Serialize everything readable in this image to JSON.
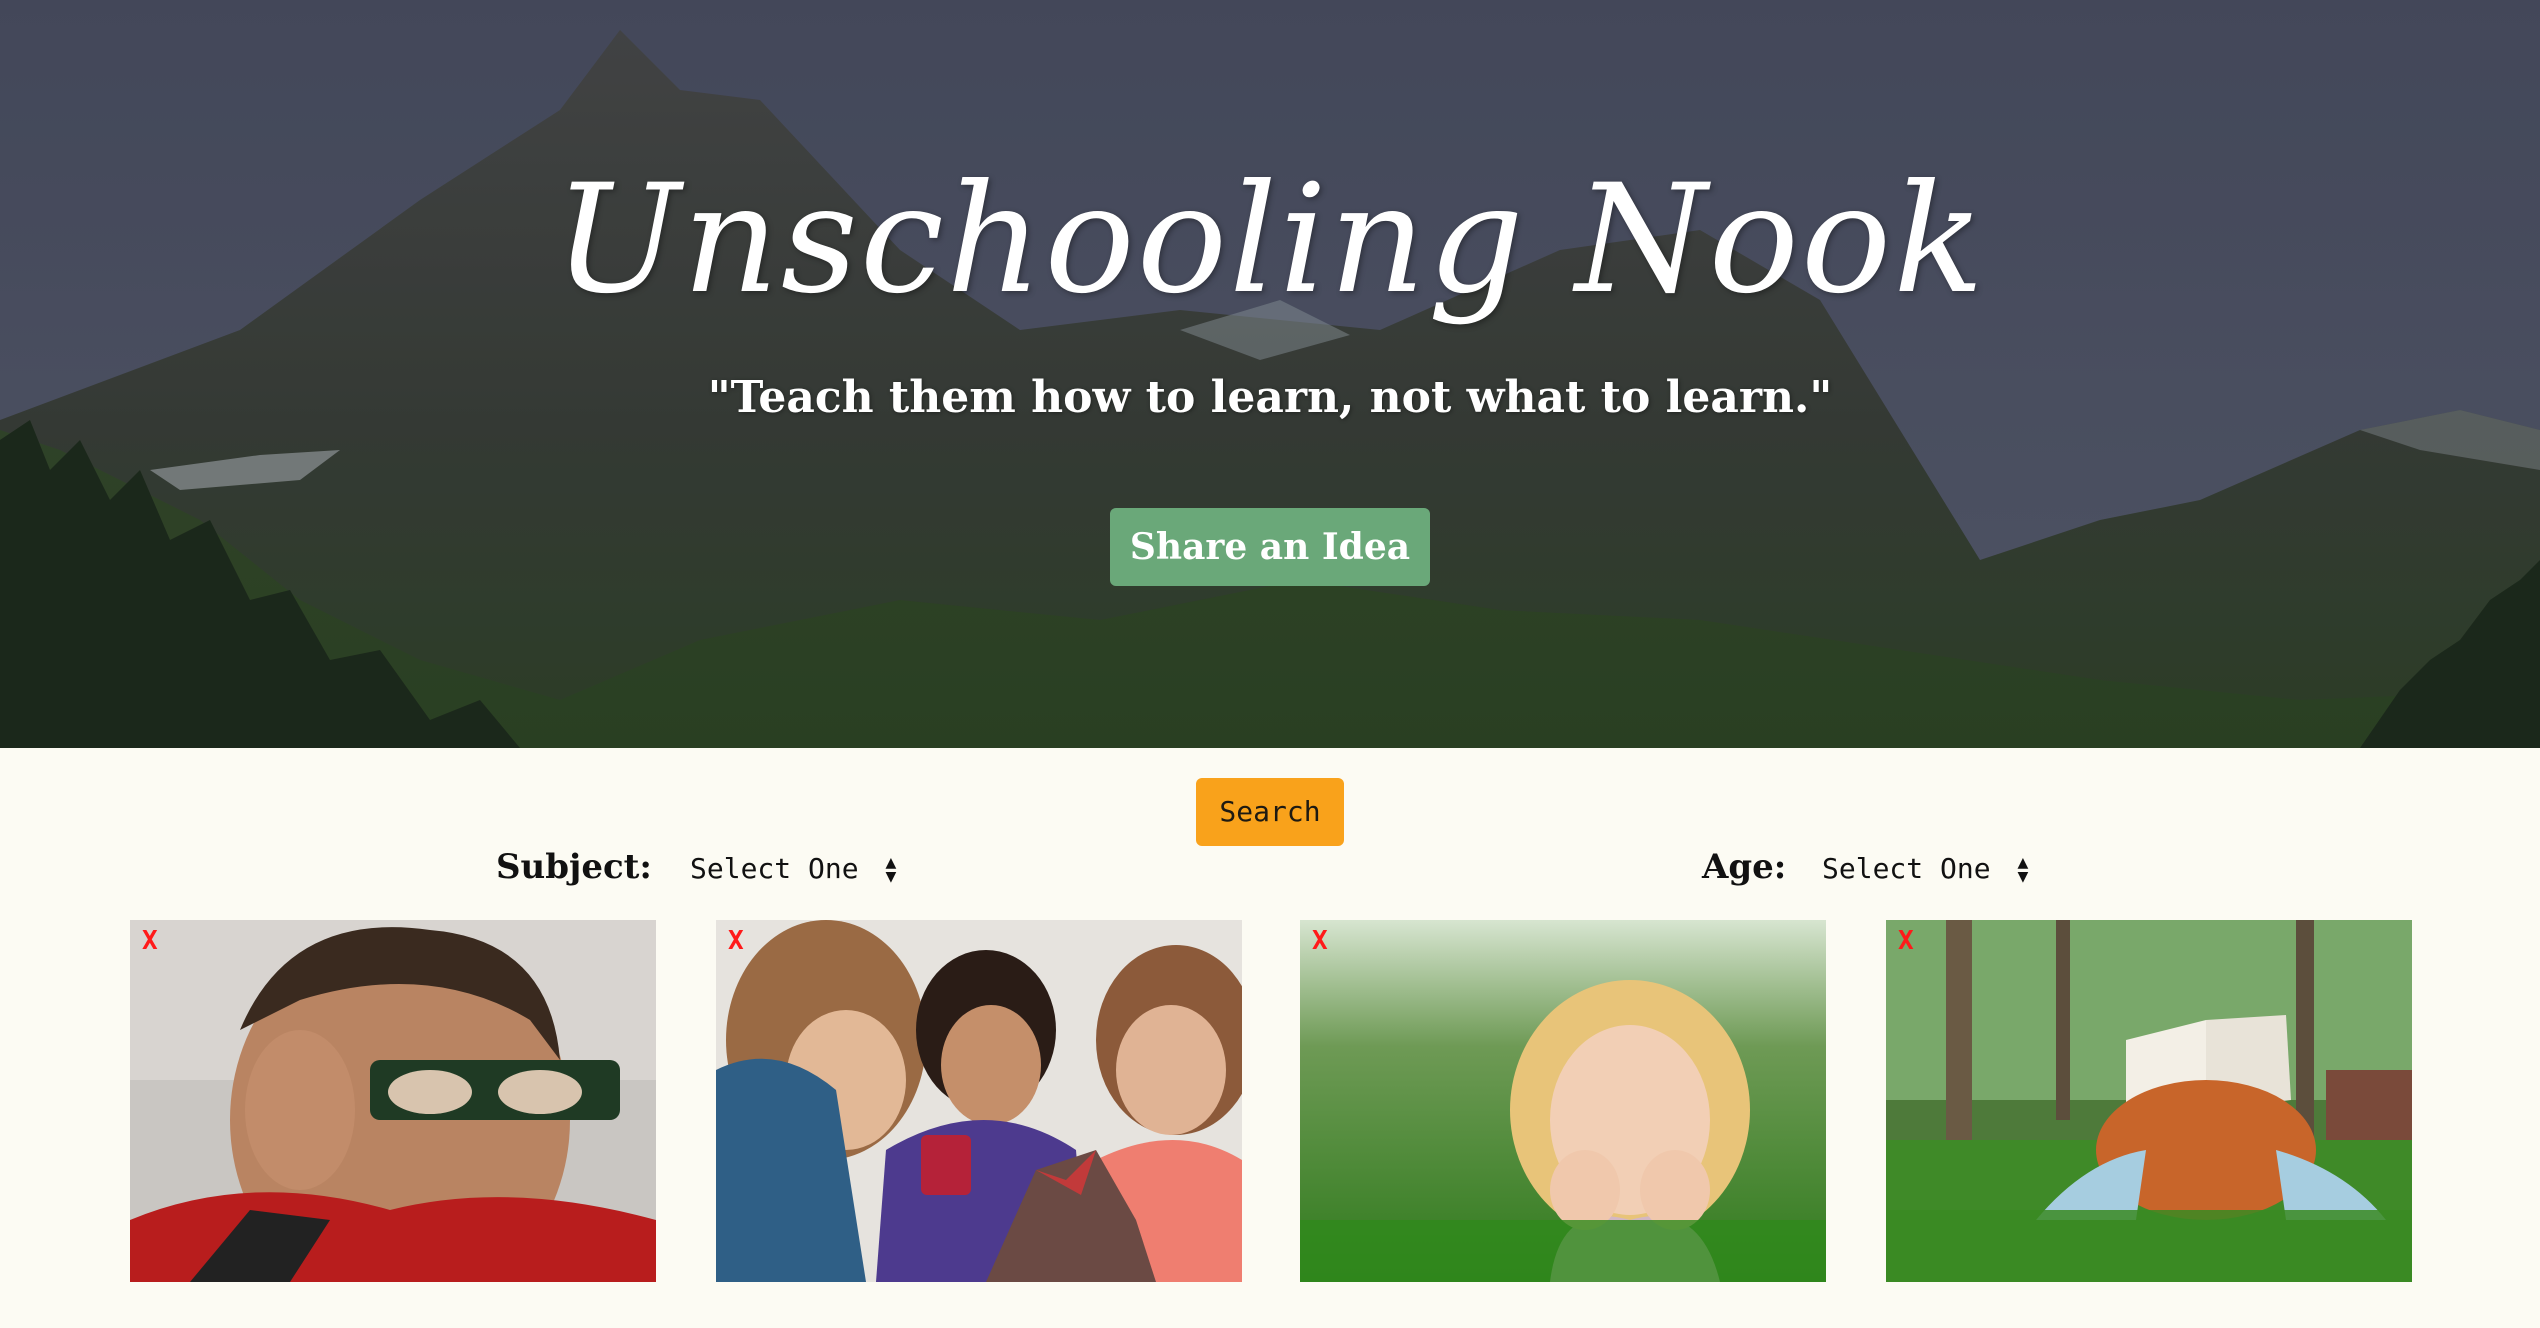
{
  "hero": {
    "title": "Unschooling Nook",
    "quote": "\"Teach them how to learn, not what to learn.\"",
    "share_label": "Share an Idea"
  },
  "search": {
    "label": "Search"
  },
  "filters": {
    "subject": {
      "label": "Subject:",
      "selected": "Select One"
    },
    "age": {
      "label": "Age:",
      "selected": "Select One"
    }
  },
  "cards": [
    {
      "remove_label": "X"
    },
    {
      "remove_label": "X"
    },
    {
      "remove_label": "X"
    },
    {
      "remove_label": "X"
    }
  ],
  "colors": {
    "page_background": "#fcfbf3",
    "share_button": "#6aa879",
    "search_button": "#f9a21b",
    "remove_x": "#ff1a1a"
  }
}
